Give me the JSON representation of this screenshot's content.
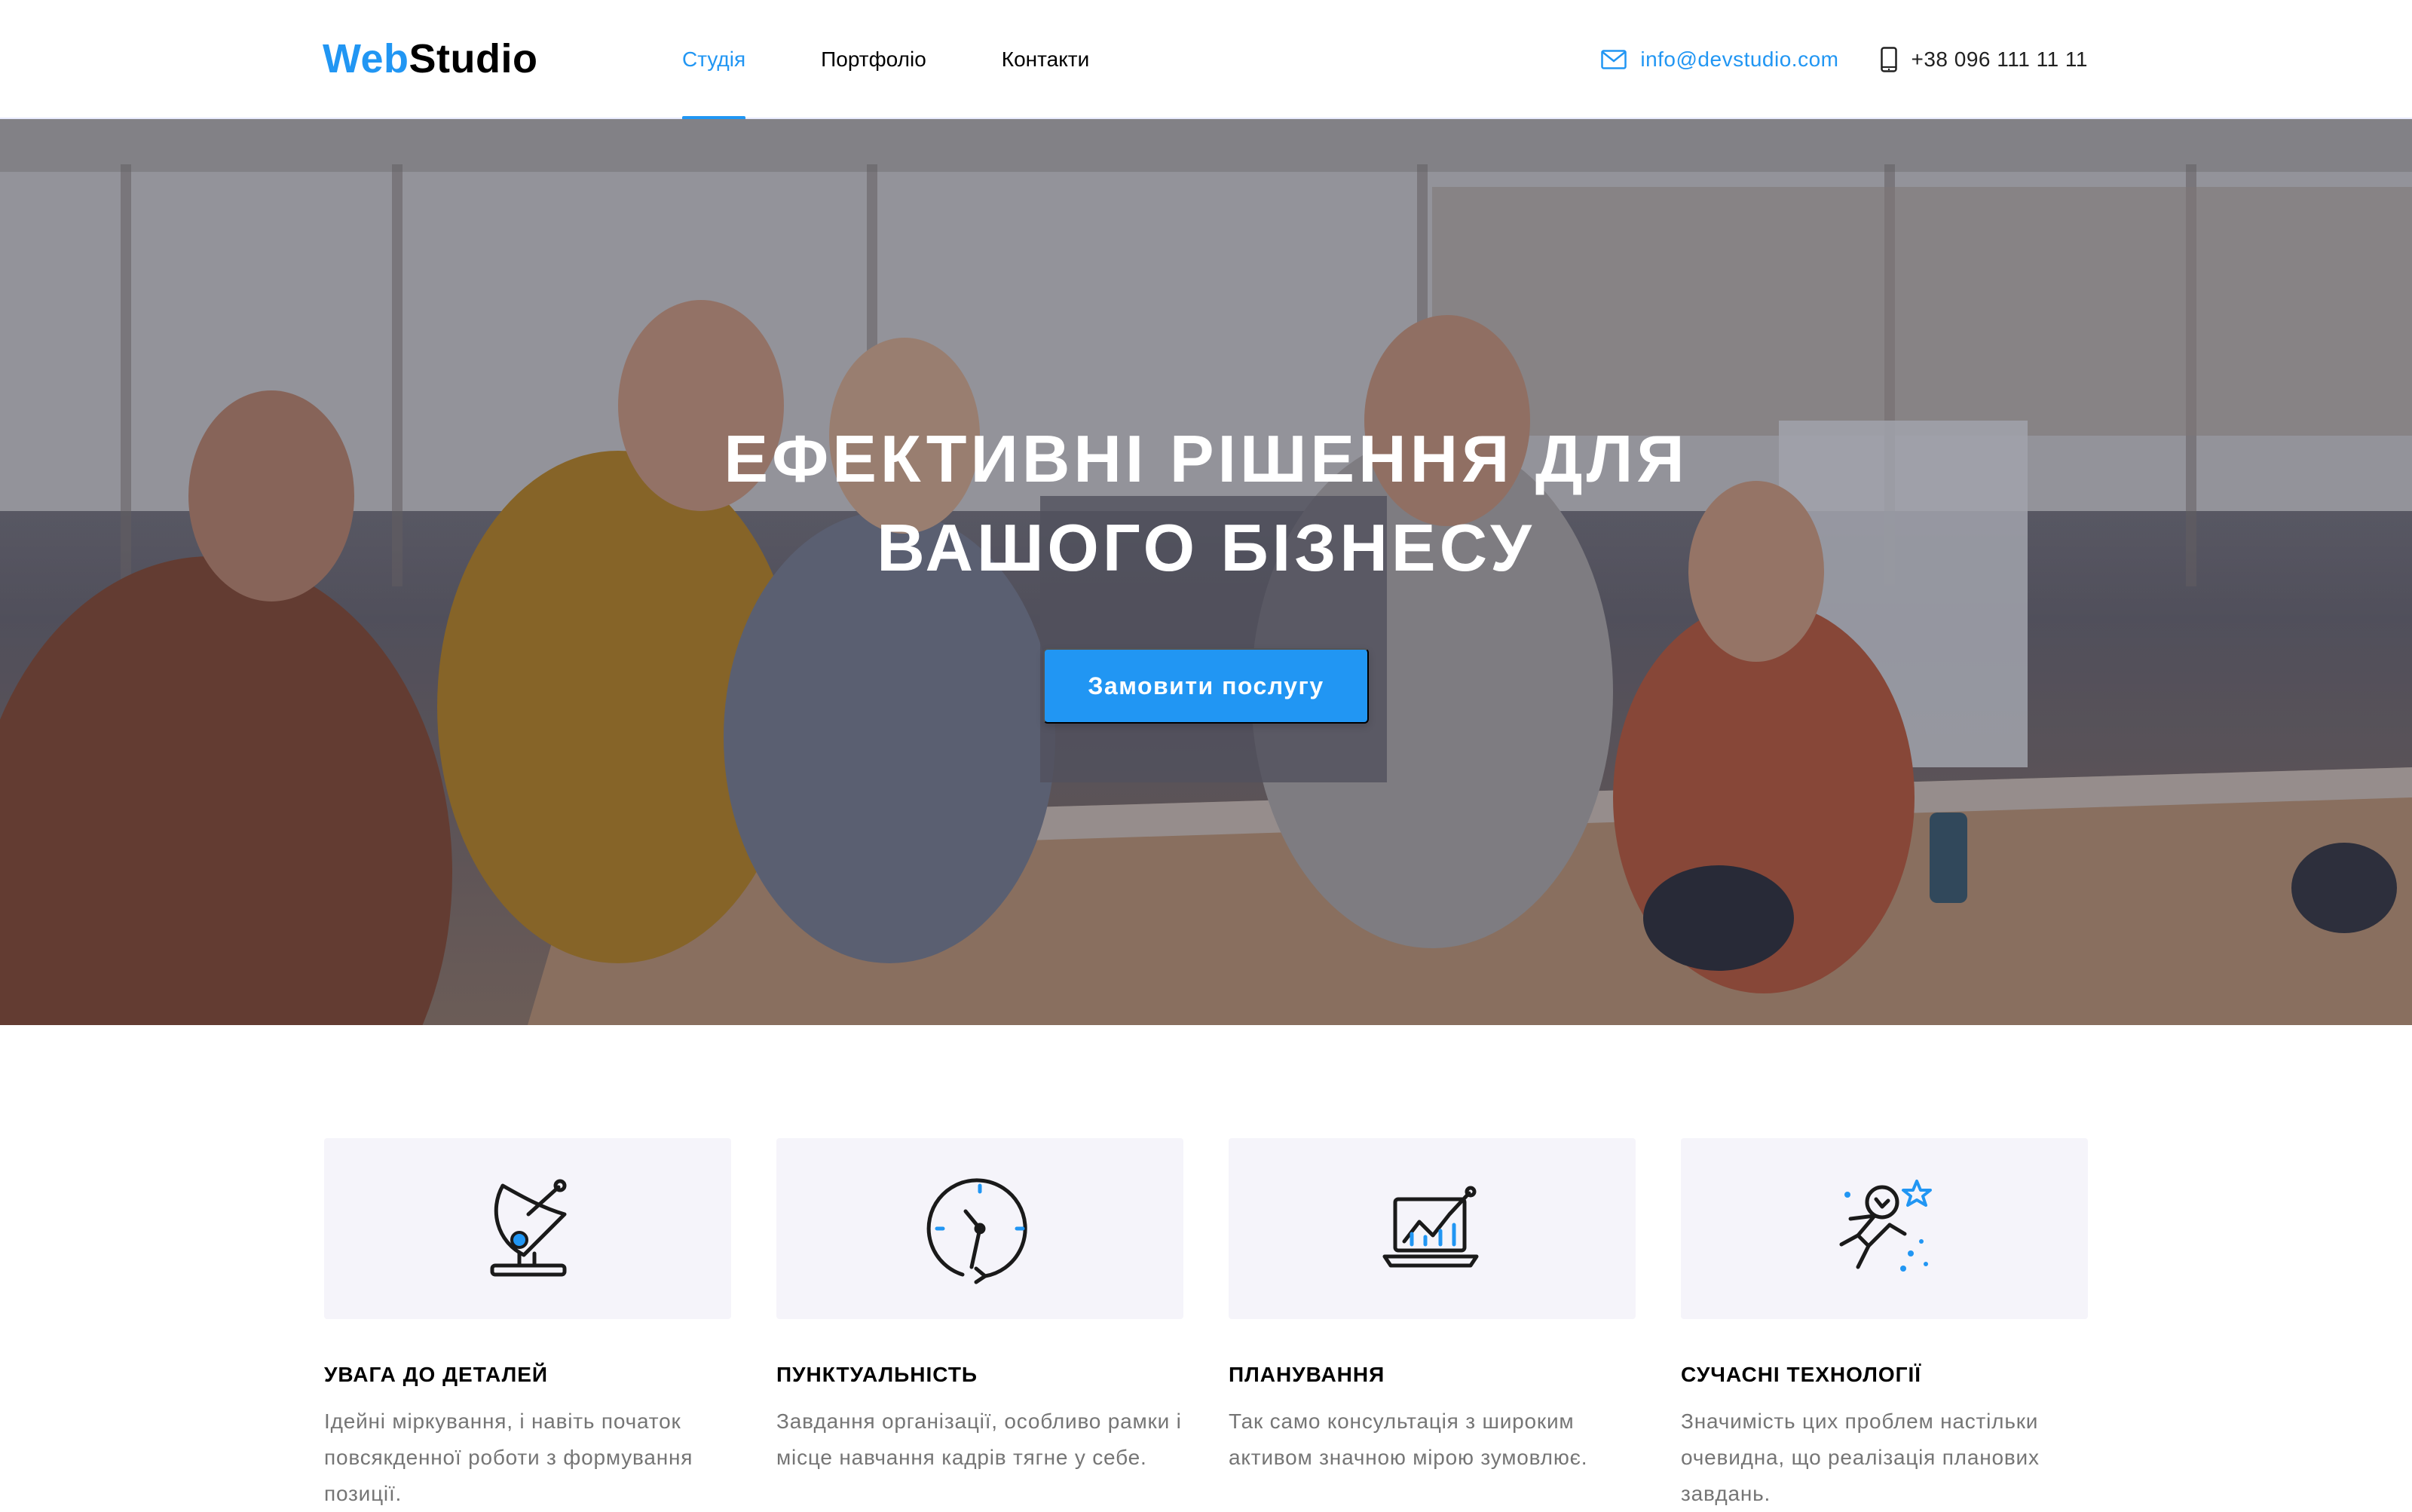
{
  "header": {
    "logo_part1": "Web",
    "logo_part2": "Studio",
    "nav": [
      {
        "label": "Студія",
        "active": true
      },
      {
        "label": "Портфоліо",
        "active": false
      },
      {
        "label": "Контакти",
        "active": false
      }
    ],
    "email": "info@devstudio.com",
    "phone": "+38 096 111 11 11",
    "email_icon": "envelope-icon",
    "phone_icon": "smartphone-icon"
  },
  "hero": {
    "title_line1": "Ефективні рішення для",
    "title_line2": "вашого бізнесу",
    "button_label": "Замовити послугу"
  },
  "features": [
    {
      "icon": "satellite-dish-icon",
      "title": "Увага до деталей",
      "text": "Ідейні міркування, і навіть початок повсякденної роботи з формування позиції."
    },
    {
      "icon": "clock-icon",
      "title": "Пунктуальність",
      "text": "Завдання організації, особливо рамки і місце навчання кадрів тягне у себе."
    },
    {
      "icon": "laptop-chart-icon",
      "title": "Планування",
      "text": "Так само консультація з широким активом значною мірою зумовлює."
    },
    {
      "icon": "astronaut-icon",
      "title": "Сучасні технології",
      "text": "Значимість цих проблем настільки очевидна, що реалізація планових завдань."
    }
  ],
  "colors": {
    "accent": "#2196f3",
    "text_dark": "#212121",
    "text_muted": "#757575",
    "feature_bg": "#f5f4fa"
  }
}
